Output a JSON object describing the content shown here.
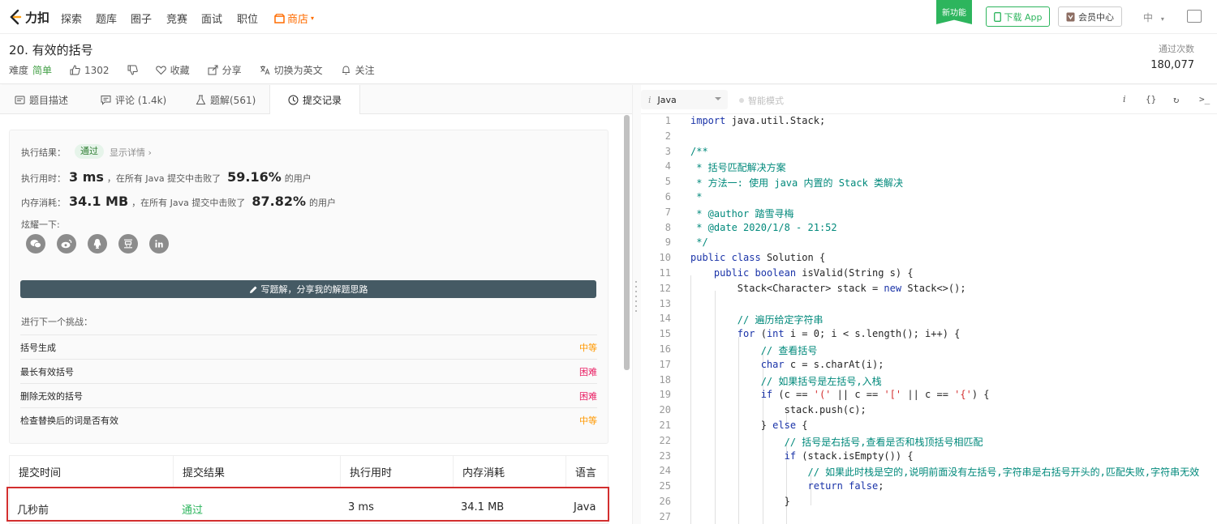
{
  "nav": {
    "logo_text": "力扣",
    "items": [
      "探索",
      "题库",
      "圈子",
      "竞赛",
      "面试",
      "职位"
    ],
    "shop": "商店",
    "new_feature": "新功能",
    "download_app": "下载 App",
    "vip": "会员中心",
    "lang": "中"
  },
  "question": {
    "title": "20. 有效的括号",
    "difficulty_label": "难度",
    "difficulty": "简单",
    "likes": "1302",
    "favorite": "收藏",
    "share": "分享",
    "switch_lang": "切换为英文",
    "follow": "关注",
    "pass_label": "通过次数",
    "pass_count": "180,077"
  },
  "tabs": [
    {
      "label": "题目描述"
    },
    {
      "label": "评论 (1.4k)"
    },
    {
      "label": "题解(561)"
    },
    {
      "label": "提交记录"
    }
  ],
  "result": {
    "exec_label": "执行结果：",
    "status": "通过",
    "detail": "显示详情 ›",
    "time_label": "执行用时：",
    "time_value": "3 ms",
    "time_mid": "，在所有 Java 提交中击败了",
    "time_pct": "59.16%",
    "users": "的用户",
    "mem_label": "内存消耗：",
    "mem_value": "34.1 MB",
    "mem_mid": "，在所有 Java 提交中击败了",
    "mem_pct": "87.82%",
    "show_off": "炫耀一下:",
    "social": [
      "wechat-icon",
      "weibo-icon",
      "qq-icon",
      "douban-icon",
      "linkedin-icon"
    ],
    "write_solution": "写题解，分享我的解题思路",
    "next_label": "进行下一个挑战："
  },
  "next": [
    {
      "title": "括号生成",
      "difficulty": "中等",
      "level": "mid"
    },
    {
      "title": "最长有效括号",
      "difficulty": "困难",
      "level": "hard"
    },
    {
      "title": "删除无效的括号",
      "difficulty": "困难",
      "level": "hard"
    },
    {
      "title": "检查替换后的词是否有效",
      "difficulty": "中等",
      "level": "mid"
    }
  ],
  "submissions": {
    "headers": [
      "提交时间",
      "提交结果",
      "执行用时",
      "内存消耗",
      "语言"
    ],
    "row": [
      "几秒前",
      "通过",
      "3 ms",
      "34.1 MB",
      "Java"
    ]
  },
  "editor": {
    "language": "Java",
    "smart_mode": "智能模式",
    "lines": [
      "import java.util.Stack;",
      "",
      "/**",
      " * 括号匹配解决方案",
      " * 方法一: 使用 java 内置的 Stack 类解决",
      " *",
      " * @author 踏雪寻梅",
      " * @date 2020/1/8 - 21:52",
      " */",
      "public class Solution {",
      "    public boolean isValid(String s) {",
      "        Stack<Character> stack = new Stack<>();",
      "",
      "        // 遍历给定字符串",
      "        for (int i = 0; i < s.length(); i++) {",
      "            // 查看括号",
      "            char c = s.charAt(i);",
      "            // 如果括号是左括号,入栈",
      "            if (c == '(' || c == '[' || c == '{') {",
      "                stack.push(c);",
      "            } else {",
      "                // 括号是右括号,查看是否和栈顶括号相匹配",
      "                if (stack.isEmpty()) {",
      "                    // 如果此时栈是空的,说明前面没有左括号,字符串是右括号开头的,匹配失败,字符串无效",
      "                    return false;",
      "                }",
      ""
    ]
  },
  "colors": {
    "brand_green": "#2db55d",
    "shop_orange": "#ff6c00",
    "highlight_red": "#d32f2f"
  }
}
